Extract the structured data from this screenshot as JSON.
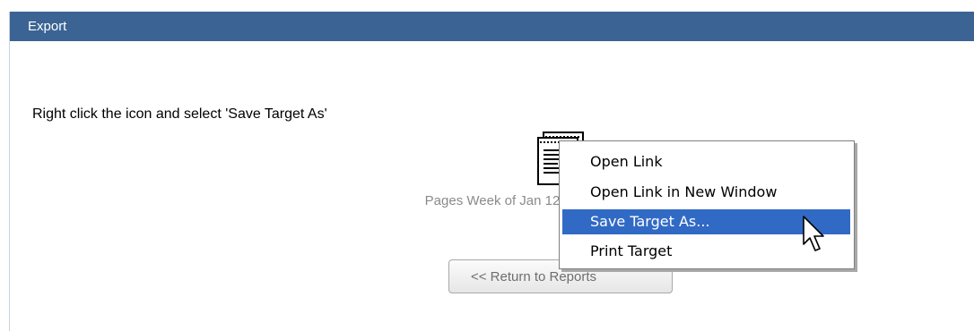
{
  "panel": {
    "header_title": "Export",
    "instruction": "Right click the icon and select 'Save Target As'",
    "file_caption": "Pages Week of Jan 12",
    "return_button_label": "<< Return to Reports"
  },
  "context_menu": {
    "items": [
      {
        "label": "Open Link",
        "selected": false
      },
      {
        "label": "Open Link in New Window",
        "selected": false
      },
      {
        "label": "Save Target As...",
        "selected": true
      },
      {
        "label": "Print Target",
        "selected": false
      }
    ]
  },
  "colors": {
    "header_bg": "#3b6494",
    "menu_highlight": "#316ac5"
  },
  "icons": {
    "file": "document-icon",
    "cursor": "mouse-pointer-icon"
  }
}
